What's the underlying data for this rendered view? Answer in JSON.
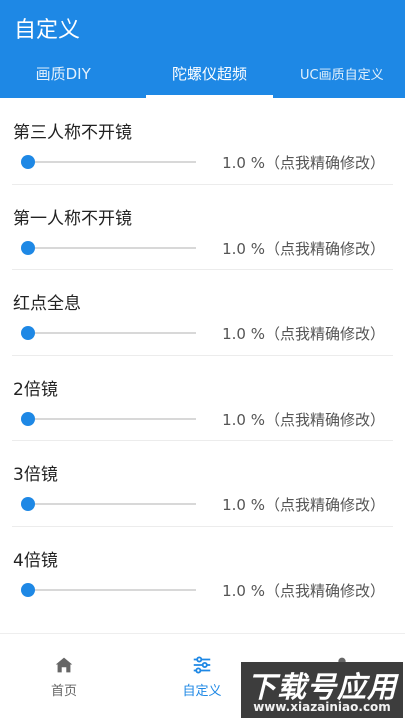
{
  "app": {
    "title": "自定义"
  },
  "tabs": [
    {
      "label": "画质DIY",
      "active": false
    },
    {
      "label": "陀螺仪超频",
      "active": true
    },
    {
      "label": "UC画质自定义",
      "active": false
    }
  ],
  "settings": [
    {
      "label": "第三人称不开镜",
      "value_text": "1.0 %（点我精确修改）",
      "level_percent": 1.0
    },
    {
      "label": "第一人称不开镜",
      "value_text": "1.0 %（点我精确修改）",
      "level_percent": 1.0
    },
    {
      "label": "红点全息",
      "value_text": "1.0 %（点我精确修改）",
      "level_percent": 1.0
    },
    {
      "label": "2倍镜",
      "value_text": "1.0 %（点我精确修改）",
      "level_percent": 1.0
    },
    {
      "label": "3倍镜",
      "value_text": "1.0 %（点我精确修改）",
      "level_percent": 1.0
    },
    {
      "label": "4倍镜",
      "value_text": "1.0 %（点我精确修改）",
      "level_percent": 1.0
    }
  ],
  "bottom_nav": [
    {
      "label": "首页",
      "icon": "home-icon",
      "active": false
    },
    {
      "label": "自定义",
      "icon": "sliders-icon",
      "active": true
    },
    {
      "label": "",
      "icon": "person-icon",
      "active": false
    }
  ],
  "watermark": {
    "title": "下载号应用",
    "url": "www.xiazainiao.com"
  },
  "colors": {
    "primary": "#1e88e5",
    "watermark_bg": "#3d3d3d"
  }
}
